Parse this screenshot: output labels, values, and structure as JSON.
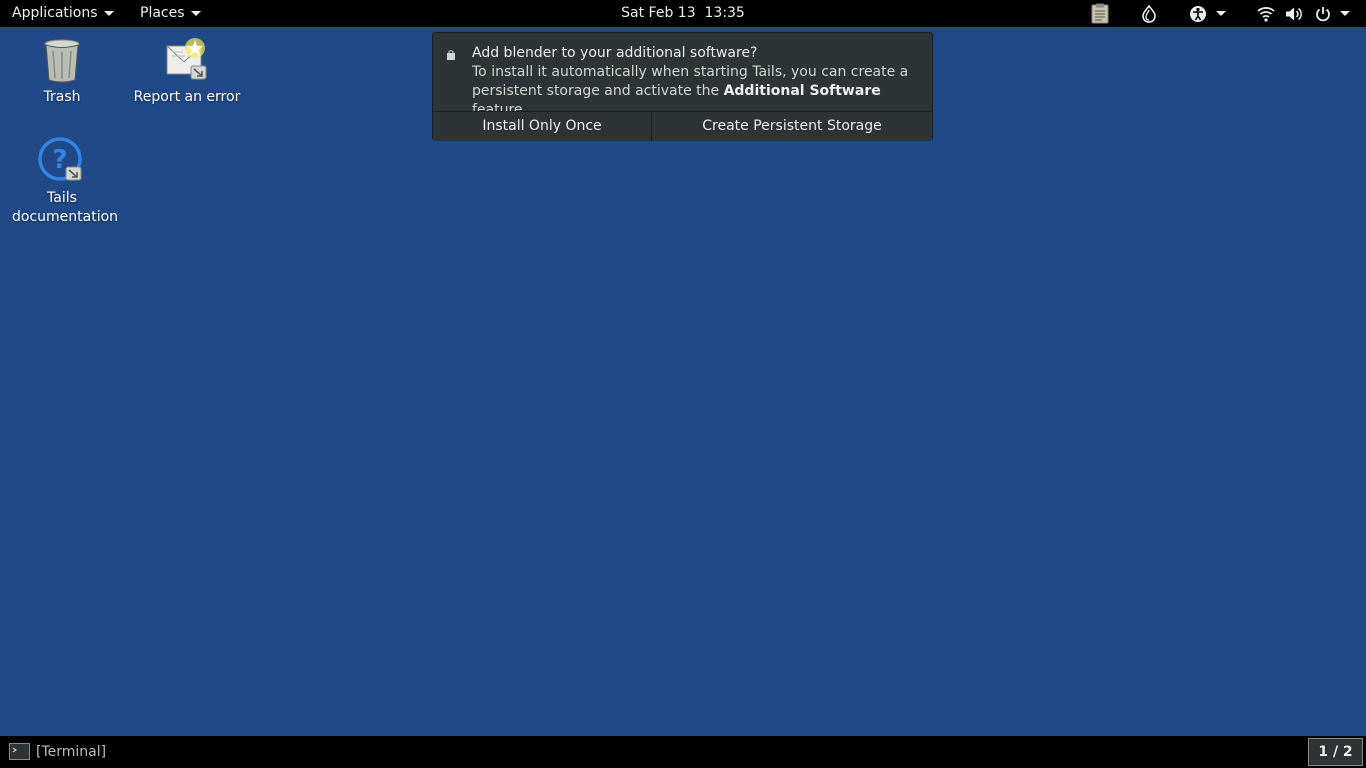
{
  "topbar": {
    "applications_label": "Applications",
    "places_label": "Places",
    "clock": "Sat Feb 13  13:35",
    "tray": [
      "clipboard-icon",
      "tor-onion-icon",
      "accessibility-icon",
      "wifi-icon",
      "volume-icon",
      "power-icon"
    ]
  },
  "desktop": {
    "icons": [
      {
        "label": "Trash",
        "icon": "trash-icon"
      },
      {
        "label": "Report an error",
        "icon": "report-error-icon"
      },
      {
        "label": "Tails documentation",
        "icon": "help-icon"
      }
    ]
  },
  "notification": {
    "title": "Add blender to your additional software?",
    "body_pre": "To install it automatically when starting Tails, you can create a persistent storage and activate the ",
    "body_bold": "Additional Software",
    "body_post": " feature.",
    "button_once": "Install Only Once",
    "button_persistent": "Create Persistent Storage"
  },
  "taskbar": {
    "window_label": "[Terminal]",
    "workspace": "1 / 2"
  },
  "colors": {
    "desktop_bg": "#204a87",
    "panel_bg": "#000000",
    "notification_bg": "#2e3436"
  }
}
